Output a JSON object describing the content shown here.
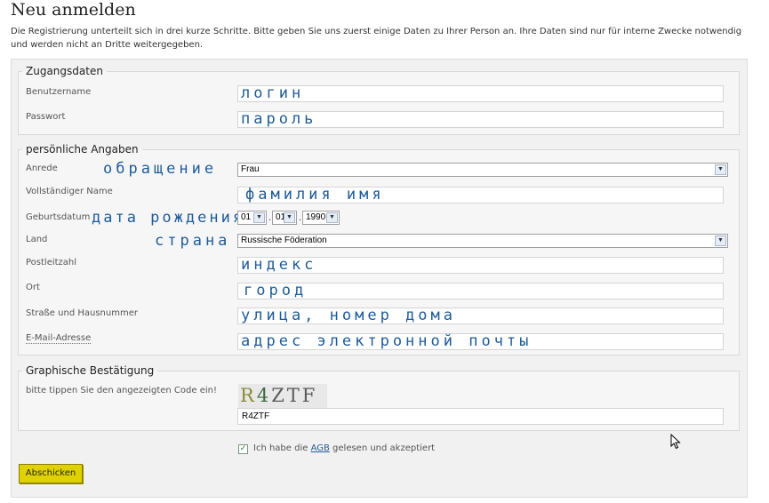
{
  "page": {
    "title": "Neu anmelden",
    "intro": "Die Registrierung unterteilt sich in drei kurze Schritte. Bitte geben Sie uns zuerst einige Daten zu Ihrer Person an. Ihre Daten sind nur für interne Zwecke notwendig und werden nicht an Dritte weitergegeben."
  },
  "access": {
    "legend": "Zugangsdaten",
    "username_label": "Benutzername",
    "username_note": "логин",
    "password_label": "Passwort",
    "password_note": "пароль"
  },
  "personal": {
    "legend": "persönliche Angaben",
    "salutation_label": "Anrede",
    "salutation_note": "обращение",
    "salutation_value": "Frau",
    "fullname_label": "Vollständiger Name",
    "fullname_note": "фамилия имя",
    "birthdate_label": "Geburtsdatum",
    "birthdate_note": "дата рождения",
    "birth_day": "01",
    "birth_month": "01",
    "birth_year": "1990",
    "sep1": ".",
    "sep2": ".",
    "country_label": "Land",
    "country_note": "страна",
    "country_value": "Russische Föderation",
    "zip_label": "Postleitzahl",
    "zip_note": "индекс",
    "city_label": "Ort",
    "city_note": "город",
    "street_label": "Straße und Hausnummer",
    "street_note": "улица, номер дома",
    "email_label": "E-Mail-Adresse",
    "email_note": "адрес электронной почты"
  },
  "captcha": {
    "legend": "Graphische Bestätigung",
    "prompt": "bitte tippen Sie den angezeigten Code ein!",
    "image_text_r": "R",
    "image_text_4": "4",
    "image_text_rest": "ZTF",
    "value": "R4ZTF"
  },
  "terms": {
    "checkmark": "✓",
    "text_before": "Ich habe die ",
    "link": "AGB",
    "text_after": " gelesen und akzeptiert"
  },
  "submit_label": "Abschicken",
  "icons": {
    "dropdown": "chevron-down-icon",
    "cursor": "mouse-cursor-icon"
  }
}
